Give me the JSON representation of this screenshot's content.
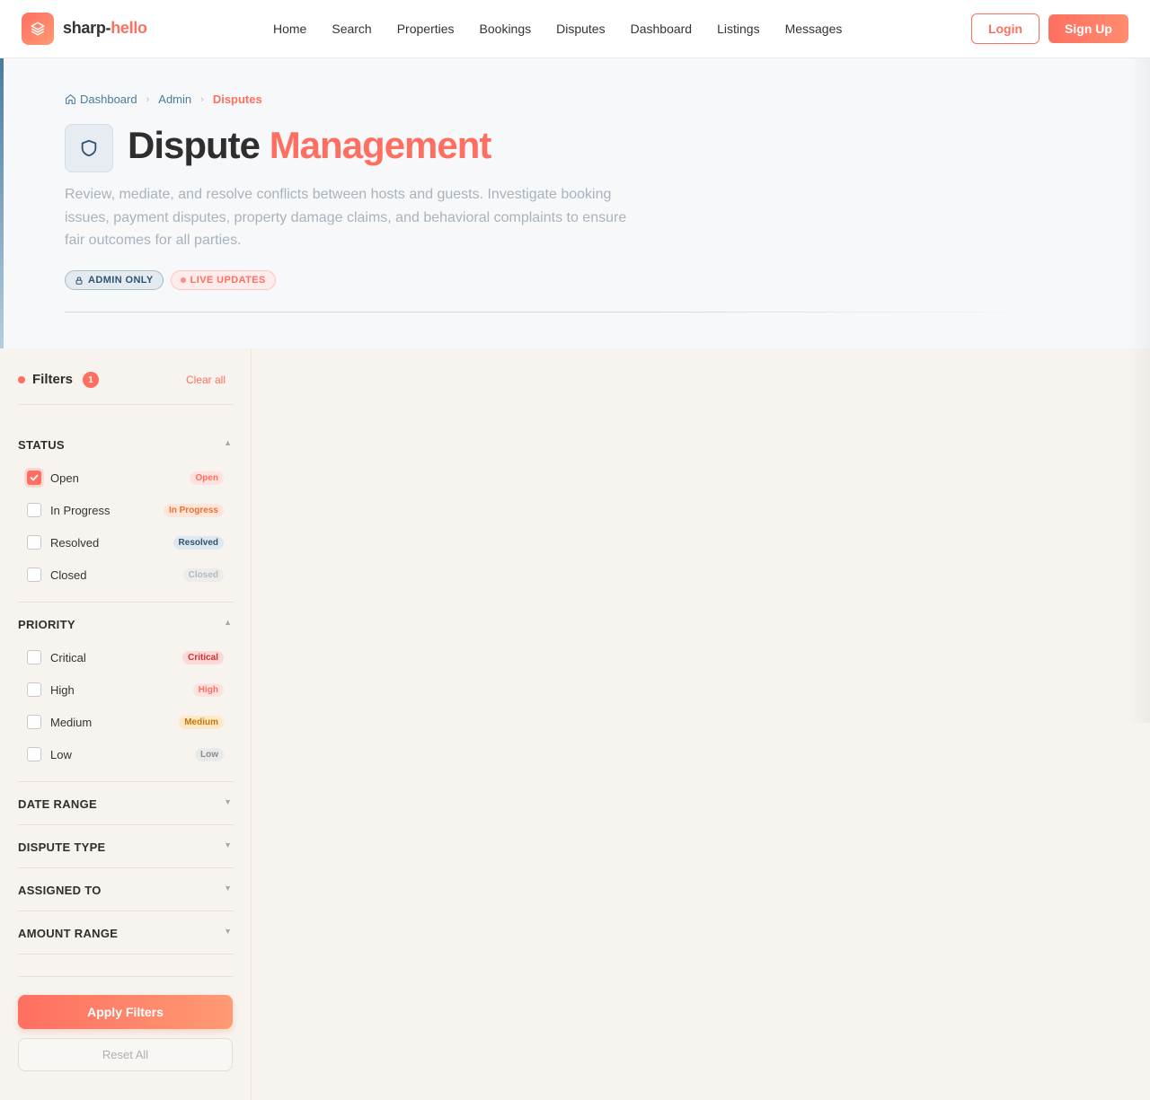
{
  "brand": {
    "name_a": "sharp-",
    "name_b": "hello",
    "logo_icon": "layers-icon"
  },
  "nav": {
    "links": [
      "Home",
      "Search",
      "Properties",
      "Bookings",
      "Disputes",
      "Dashboard",
      "Listings",
      "Messages"
    ],
    "login": "Login",
    "signup": "Sign Up"
  },
  "breadcrumb": {
    "home": "Dashboard",
    "admin": "Admin",
    "current": "Disputes"
  },
  "hero": {
    "title_a": "Dispute",
    "title_b": "Management",
    "icon": "shield-icon",
    "description": "Review, mediate, and resolve conflicts between hosts and guests. Investigate booking issues, payment disputes, property damage claims, and behavioral complaints to ensure fair outcomes for all parties.",
    "badge_admin": "ADMIN ONLY",
    "badge_live": "LIVE UPDATES"
  },
  "filters": {
    "title": "Filters",
    "count": "1",
    "clear": "Clear all",
    "status": {
      "title": "STATUS",
      "options": [
        {
          "label": "Open",
          "tag": "Open",
          "checked": true
        },
        {
          "label": "In Progress",
          "tag": "In Progress",
          "checked": false
        },
        {
          "label": "Resolved",
          "tag": "Resolved",
          "checked": false
        },
        {
          "label": "Closed",
          "tag": "Closed",
          "checked": false
        }
      ]
    },
    "priority": {
      "title": "PRIORITY",
      "options": [
        {
          "label": "Critical",
          "tag": "Critical",
          "checked": false
        },
        {
          "label": "High",
          "tag": "High",
          "checked": false
        },
        {
          "label": "Medium",
          "tag": "Medium",
          "checked": false
        },
        {
          "label": "Low",
          "tag": "Low",
          "checked": false
        }
      ]
    },
    "collapsed_sections": [
      "DATE RANGE",
      "DISPUTE TYPE",
      "ASSIGNED TO",
      "AMOUNT RANGE"
    ],
    "apply": "Apply Filters",
    "reset": "Reset All"
  },
  "colors": {
    "accent": "#ff6f61",
    "secondary": "#4a7b9d",
    "background": "#f7f4ef"
  }
}
